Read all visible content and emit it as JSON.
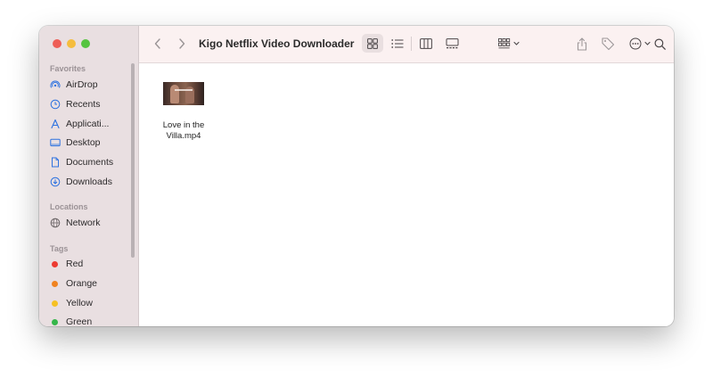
{
  "window": {
    "title": "Kigo Netflix Video Downloader"
  },
  "sidebar": {
    "favorites_label": "Favorites",
    "favorites": [
      {
        "label": "AirDrop",
        "icon": "airdrop-icon"
      },
      {
        "label": "Recents",
        "icon": "clock-icon"
      },
      {
        "label": "Applicati...",
        "icon": "applications-icon"
      },
      {
        "label": "Desktop",
        "icon": "desktop-icon"
      },
      {
        "label": "Documents",
        "icon": "document-icon"
      },
      {
        "label": "Downloads",
        "icon": "download-icon"
      }
    ],
    "locations_label": "Locations",
    "locations": [
      {
        "label": "Network",
        "icon": "globe-icon"
      }
    ],
    "tags_label": "Tags",
    "tags": [
      {
        "label": "Red",
        "color": "#ec3b32"
      },
      {
        "label": "Orange",
        "color": "#f08320"
      },
      {
        "label": "Yellow",
        "color": "#f6c123"
      },
      {
        "label": "Green",
        "color": "#35b64a"
      }
    ]
  },
  "toolbar": {
    "view_mode_selected": "icon-view",
    "icons": [
      "back-icon",
      "forward-icon",
      "icon-view-icon",
      "list-view-icon",
      "column-view-icon",
      "gallery-view-icon",
      "group-icon",
      "share-icon",
      "tag-icon",
      "more-icon",
      "search-icon"
    ]
  },
  "files": [
    {
      "name_line1": "Love in the",
      "name_line2": "Villa.mp4",
      "kind": "video-thumbnail"
    }
  ],
  "colors": {
    "sidebar_bg": "#e9dfe1",
    "toolbar_bg": "#fbf1f1",
    "accent": "#2d72e0"
  }
}
